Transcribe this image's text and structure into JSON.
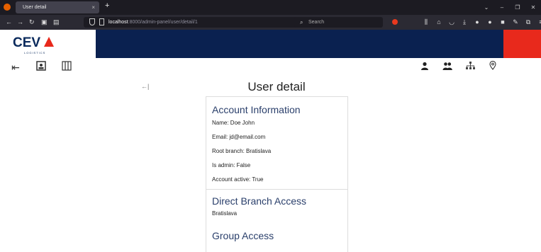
{
  "browser": {
    "tab_title": "User detail",
    "tab_close": "×",
    "new_tab": "+",
    "url_host": "localhost",
    "url_rest": ":8000/admin-panel/user/detail/1",
    "search_placeholder": "Search"
  },
  "toolbar_right_icons": [
    "user-icon",
    "users-icon",
    "sitemap-icon",
    "location-pin-icon"
  ],
  "toolbar_left_icons": [
    "logout-icon",
    "id-card-icon",
    "columns-icon"
  ],
  "page": {
    "title": "User detail"
  },
  "account": {
    "heading": "Account Information",
    "name": "Name: Doe John",
    "email": "Email: jd@email.com",
    "root_branch": "Root branch: Bratislava",
    "is_admin": "Is admin: False",
    "account_active": "Account active: True"
  },
  "branch_access": {
    "heading": "Direct Branch Access",
    "items": [
      "Bratislava"
    ]
  },
  "group_access": {
    "heading": "Group Access"
  },
  "colors": {
    "header_band": "#0a2150",
    "header_accent": "#e8291c",
    "section_title": "#2a3f6b"
  }
}
